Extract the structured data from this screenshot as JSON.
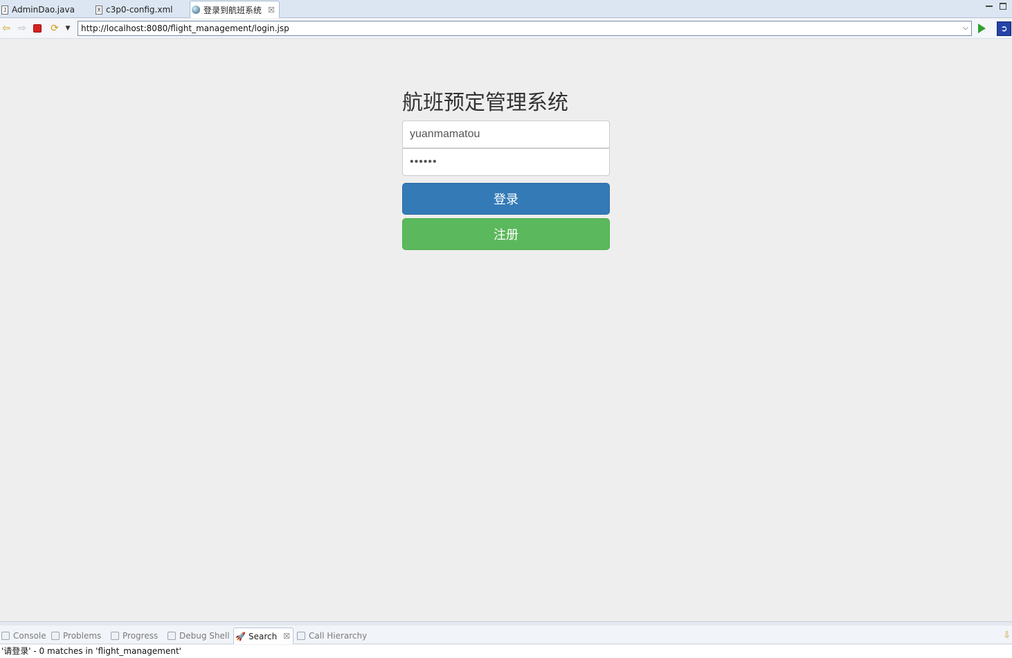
{
  "editor_tabs": [
    {
      "label": "AdminDao.java",
      "icon": "java-file-icon",
      "glyph": "J"
    },
    {
      "label": "c3p0-config.xml",
      "icon": "xml-file-icon",
      "glyph": "X"
    },
    {
      "label": "登录到航班系统",
      "icon": "globe-icon",
      "close": "☒"
    }
  ],
  "browser": {
    "url": "http://localhost:8080/flight_management/login.jsp"
  },
  "login": {
    "title": "航班预定管理系统",
    "username_value": "yuanmamatou",
    "password_value": "••••••",
    "login_label": "登录",
    "register_label": "注册"
  },
  "views": {
    "tabs": [
      {
        "label": "Console",
        "icon": "console-icon"
      },
      {
        "label": "Problems",
        "icon": "problems-icon"
      },
      {
        "label": "Progress",
        "icon": "progress-icon"
      },
      {
        "label": "Debug Shell",
        "icon": "debug-shell-icon"
      },
      {
        "label": "Search",
        "icon": "search-icon",
        "close": "☒"
      },
      {
        "label": "Call Hierarchy",
        "icon": "call-hierarchy-icon"
      }
    ],
    "search_result": "'请登录' - 0 matches in 'flight_management'"
  },
  "colors": {
    "login_button": "#337ab7",
    "register_button": "#5cb85c",
    "page_background": "#eeeeee"
  }
}
